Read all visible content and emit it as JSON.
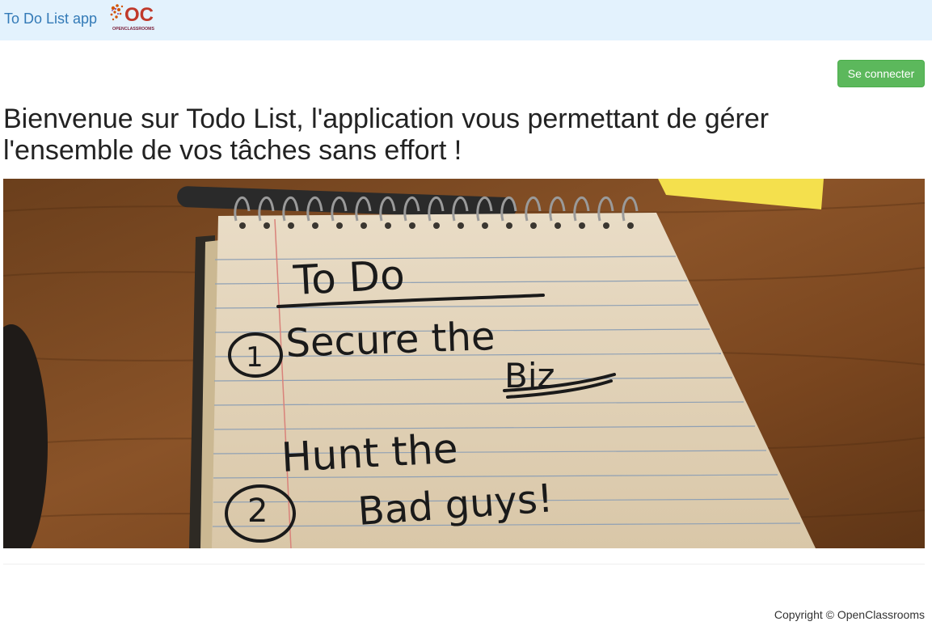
{
  "navbar": {
    "brand": "To Do List app",
    "logo_text": "OPENCLASSROOMS",
    "logo_monogram": "OC"
  },
  "actions": {
    "login_label": "Se connecter"
  },
  "main": {
    "title": "Bienvenue sur Todo List, l'application vous permettant de gérer l'ensemble de vos tâches sans effort !",
    "hero": {
      "heading": "To Do",
      "item1_num": "1",
      "item1_line1": "Secure the",
      "item1_line2": "Biz",
      "item2_line1": "Hunt the",
      "item2_num": "2",
      "item2_line2": "Bad guys!"
    }
  },
  "footer": {
    "copyright": "Copyright © OpenClassrooms"
  },
  "colors": {
    "navbar_bg": "#e3f2fd",
    "brand_link": "#337ab7",
    "success_button": "#5cb85c",
    "logo_red": "#c0392b"
  }
}
